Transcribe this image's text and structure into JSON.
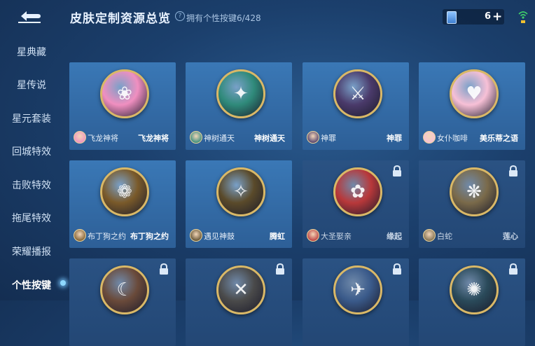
{
  "header": {
    "title": "皮肤定制资源总览",
    "owned_text": "拥有个性按键6/428",
    "currency_value": "6"
  },
  "sidebar": {
    "items": [
      {
        "label": "星典藏"
      },
      {
        "label": "星传说"
      },
      {
        "label": "星元套装"
      },
      {
        "label": "回城特效"
      },
      {
        "label": "击败特效"
      },
      {
        "label": "拖尾特效"
      },
      {
        "label": "荣耀播报"
      },
      {
        "label": "个性按键",
        "active": true
      }
    ]
  },
  "cards": [
    {
      "hero": "飞龙神将",
      "skin": "飞龙神将",
      "locked": false,
      "orb_color": "#f08fc0",
      "glyph": "❀"
    },
    {
      "hero": "神树通天",
      "skin": "神树通天",
      "locked": false,
      "orb_color": "#2f8a7a",
      "glyph": "✦"
    },
    {
      "hero": "神罪",
      "skin": "神罪",
      "locked": false,
      "orb_color": "#4a3a6a",
      "glyph": "⚔"
    },
    {
      "hero": "女仆咖啡",
      "skin": "美乐蒂之语",
      "locked": false,
      "orb_color": "#f7c0d6",
      "glyph": "♥"
    },
    {
      "hero": "布丁狗之约",
      "skin": "布丁狗之约",
      "locked": false,
      "orb_color": "#7a5a2a",
      "glyph": "❁"
    },
    {
      "hero": "遇见神鼓",
      "skin": "腾虹",
      "locked": false,
      "orb_color": "#5a4a2a",
      "glyph": "✧"
    },
    {
      "hero": "大圣娶亲",
      "skin": "缘起",
      "locked": true,
      "orb_color": "#b8383a",
      "glyph": "✿"
    },
    {
      "hero": "白蛇",
      "skin": "莲心",
      "locked": true,
      "orb_color": "#7a6a4a",
      "glyph": "❋"
    },
    {
      "hero": "",
      "skin": "",
      "locked": true,
      "orb_color": "#6a4a3a",
      "glyph": "☾"
    },
    {
      "hero": "",
      "skin": "",
      "locked": true,
      "orb_color": "#4a4a4a",
      "glyph": "✕"
    },
    {
      "hero": "",
      "skin": "",
      "locked": true,
      "orb_color": "#3a5a8a",
      "glyph": "✈"
    },
    {
      "hero": "",
      "skin": "",
      "locked": true,
      "orb_color": "#2a4a5a",
      "glyph": "✺"
    }
  ]
}
